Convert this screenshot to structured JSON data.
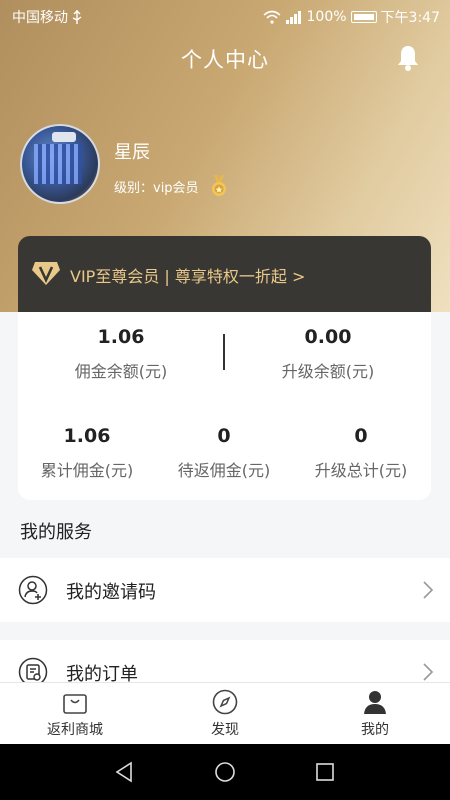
{
  "status_bar": {
    "carrier": "中国移动",
    "battery": "100%",
    "time": "下午3:47"
  },
  "header": {
    "title": "个人中心",
    "bell_icon": "bell-icon"
  },
  "profile": {
    "username": "星辰",
    "level_label": "级别：vip会员",
    "medal_icon": "medal-icon"
  },
  "vip_banner": {
    "text": "VIP至尊会员 | 尊享特权一折起 >",
    "accent_color": "#e8c98a"
  },
  "stats": {
    "top": [
      {
        "value": "1.06",
        "label": "佣金余额(元)"
      },
      {
        "value": "0.00",
        "label": "升级余额(元)"
      }
    ],
    "bottom": [
      {
        "value": "1.06",
        "label": "累计佣金(元)"
      },
      {
        "value": "0",
        "label": "待返佣金(元)"
      },
      {
        "value": "0",
        "label": "升级总计(元)"
      }
    ]
  },
  "services": {
    "title": "我的服务",
    "items": [
      {
        "label": "我的邀请码",
        "icon": "user-add-icon"
      },
      {
        "label": "我的订单",
        "icon": "order-icon"
      }
    ]
  },
  "tabbar": {
    "items": [
      {
        "label": "返利商城",
        "icon": "shopping-bag-icon",
        "active": false
      },
      {
        "label": "发现",
        "icon": "compass-icon",
        "active": false
      },
      {
        "label": "我的",
        "icon": "person-icon",
        "active": true
      }
    ]
  }
}
